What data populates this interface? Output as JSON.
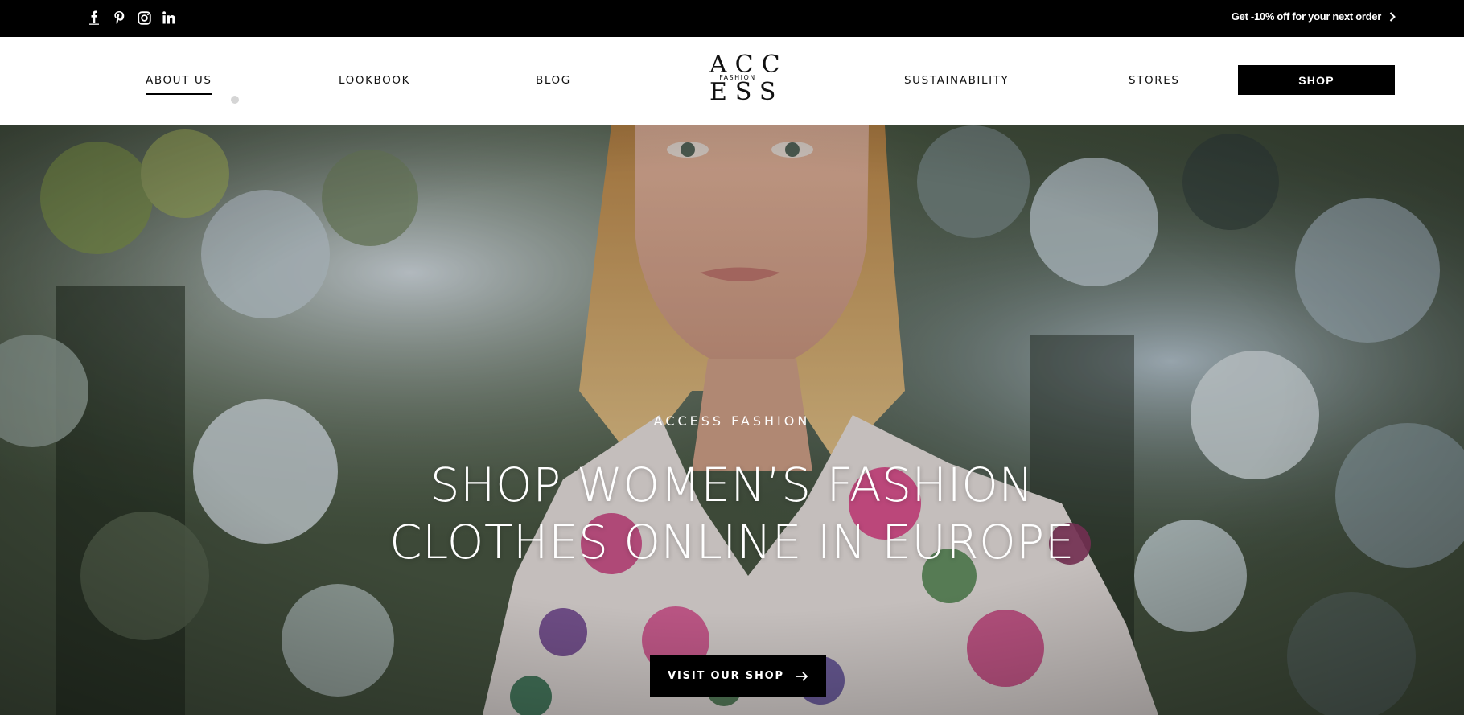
{
  "topbar": {
    "social": [
      {
        "icon": "facebook-icon",
        "glyph": "f"
      },
      {
        "icon": "pinterest-icon",
        "glyph": "p"
      },
      {
        "icon": "instagram-icon",
        "glyph": ""
      },
      {
        "icon": "linkedin-icon",
        "glyph": "in"
      }
    ],
    "promo_text": "Get -10% off for your next order",
    "promo_icon": "chevron-right-icon"
  },
  "nav": {
    "about": "ABOUT US",
    "lookbook": "LOOKBOOK",
    "blog": "BLOG",
    "sustainability": "SUSTAINABILITY",
    "stores": "STORES",
    "shop": "SHOP"
  },
  "logo": {
    "line1": "ACC",
    "line2": "FASHION",
    "line3": "ESS"
  },
  "hero": {
    "kicker": "ACCESS FASHION",
    "headline": "SHOP WOMEN’S FASHION CLOTHES ONLINE IN EUROPE",
    "cta_label": "VISIT OUR SHOP",
    "cta_icon": "arrow-right-icon"
  },
  "colors": {
    "black": "#000000",
    "white": "#ffffff",
    "dot": "#d5d5d5"
  }
}
